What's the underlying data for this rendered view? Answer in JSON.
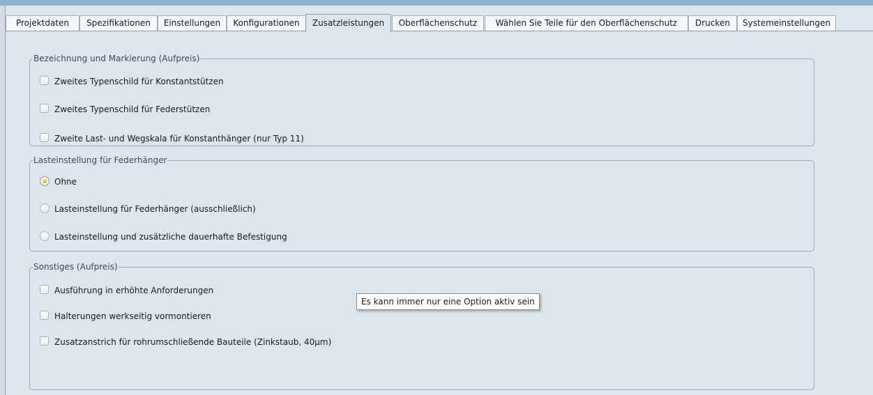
{
  "tabs": [
    {
      "label": "Projektdaten",
      "active": false
    },
    {
      "label": "Spezifikationen",
      "active": false
    },
    {
      "label": "Einstellungen",
      "active": false
    },
    {
      "label": "Konfigurationen",
      "active": false
    },
    {
      "label": "Zusatzleistungen",
      "active": true
    },
    {
      "label": "Oberflächenschutz",
      "active": false
    },
    {
      "label": "Wählen Sie Teile für den Oberflächenschutz",
      "active": false
    },
    {
      "label": "Drucken",
      "active": false
    },
    {
      "label": "Systemeinstellungen",
      "active": false
    }
  ],
  "marking_group": {
    "title": "Bezeichnung und Markierung (Aufpreis)",
    "options": [
      {
        "label": "Zweites Typenschild für Konstantstützen",
        "checked": false
      },
      {
        "label": "Zweites Typenschild für Federstützen",
        "checked": false
      },
      {
        "label": "Zweite Last- und Wegskala für Konstanthänger (nur Typ 11)",
        "checked": false
      }
    ]
  },
  "load_group": {
    "title": "Lasteinstellung für Federhänger",
    "options": [
      {
        "label": "Ohne",
        "selected": true
      },
      {
        "label": "Lasteinstellung für Federhänger (ausschließlich)",
        "selected": false
      },
      {
        "label": "Lasteinstellung und zusätzliche dauerhafte Befestigung",
        "selected": false
      }
    ]
  },
  "misc_group": {
    "title": "Sonstiges (Aufpreis)",
    "options": [
      {
        "label": "Ausführung in erhöhte Anforderungen",
        "checked": false
      },
      {
        "label": "Halterungen werkseitig vormontieren",
        "checked": false
      },
      {
        "label": "Zusatzanstrich für rohrumschließende Bauteile (Zinkstaub, 40µm)",
        "checked": false
      }
    ]
  },
  "tooltip": "Es kann immer nur eine Option aktiv sein",
  "colors": {
    "panel_background": "#dde6ee",
    "group_border": "#9aa8b6",
    "title_strip": "#8fb0cf",
    "radio_selected": "#c99a1e"
  }
}
